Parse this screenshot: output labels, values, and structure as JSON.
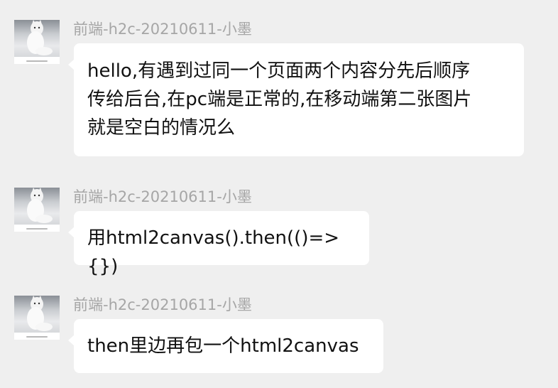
{
  "messages": [
    {
      "sender": "前端-h2c-20210611-小墨",
      "avatar": "white-cat-avatar",
      "text": "hello,有遇到过同一个页面两个内容分先后顺序\n传给后台,在pc端是正常的,在移动端第二张图片\n就是空白的情况么"
    },
    {
      "sender": "前端-h2c-20210611-小墨",
      "avatar": "white-cat-avatar",
      "text": "用html2canvas().then(()=>{})"
    },
    {
      "sender": "前端-h2c-20210611-小墨",
      "avatar": "white-cat-avatar",
      "text": "then里边再包一个html2canvas"
    }
  ],
  "colors": {
    "background": "#efefef",
    "bubble": "#ffffff",
    "sender_name": "#a6a6a6",
    "message_text": "#111111"
  }
}
